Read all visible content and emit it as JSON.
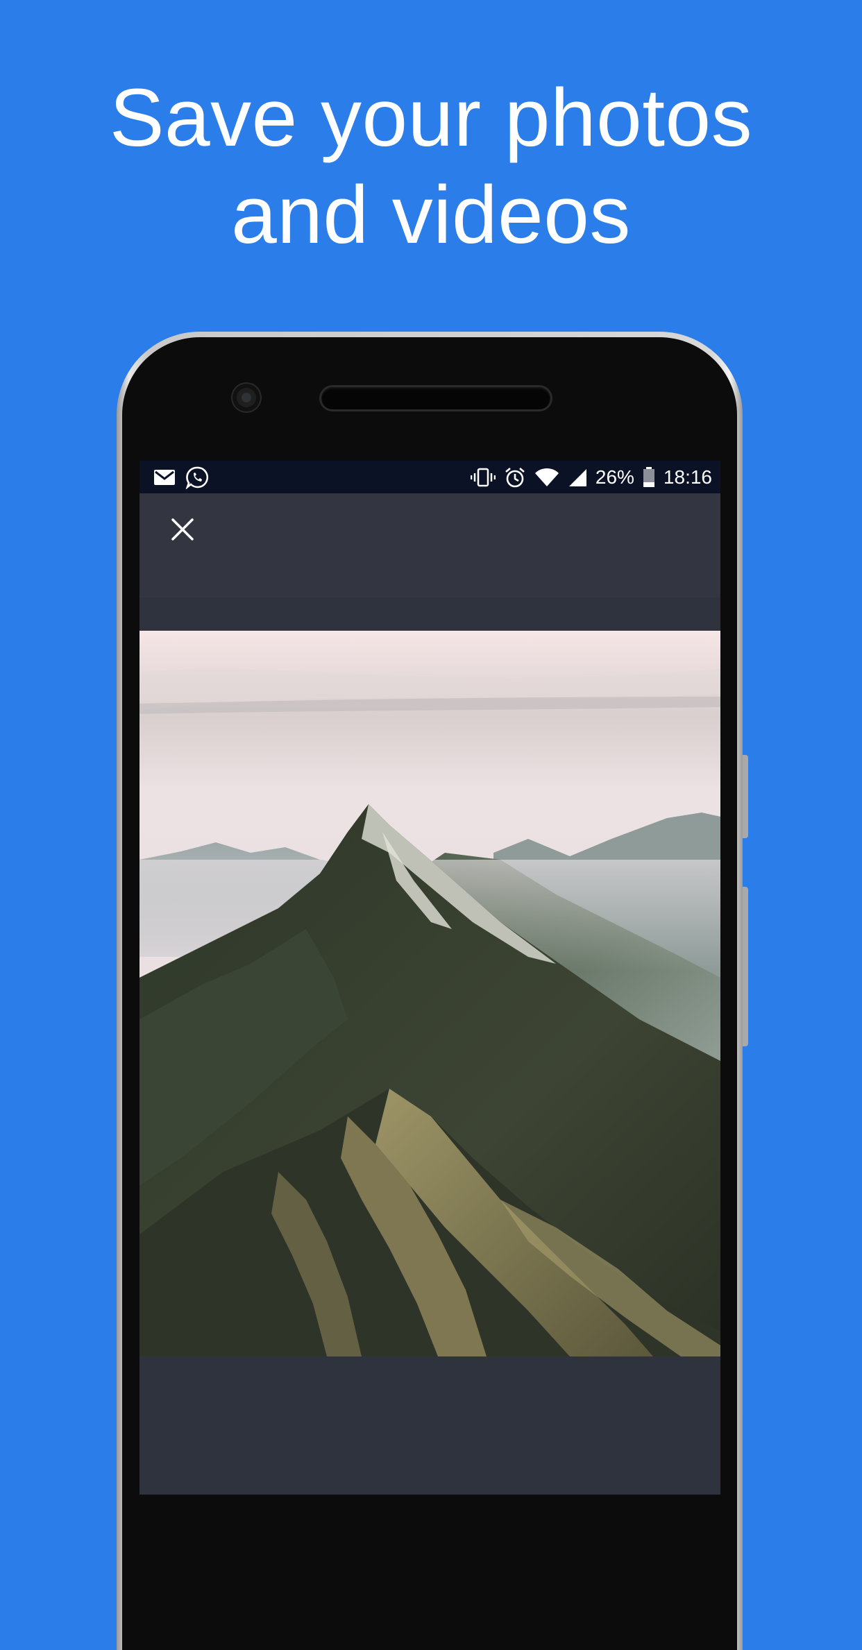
{
  "headline": {
    "line1": "Save your photos",
    "line2": "and videos"
  },
  "colors": {
    "background": "#2b7de9",
    "screen": "#2f333d",
    "status_bar": "#0b1226"
  },
  "status_bar": {
    "left_icons": [
      "gmail-icon",
      "whatsapp-icon"
    ],
    "right_icons": [
      "vibrate-icon",
      "alarm-icon",
      "wifi-icon",
      "signal-icon",
      "battery-icon"
    ],
    "battery_percent": "26%",
    "time": "18:16"
  },
  "toolbar": {
    "close_icon": "close-icon"
  },
  "photo": {
    "subject": "mountain-photo"
  }
}
